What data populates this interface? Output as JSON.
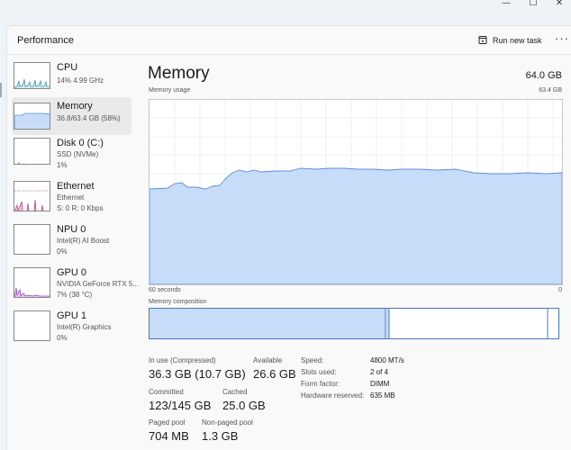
{
  "window": {
    "minimize_glyph": "—",
    "maximize_glyph": "☐",
    "close_glyph": "✕"
  },
  "header": {
    "title": "Performance",
    "run_new_task": "Run new task",
    "more_glyph": "···"
  },
  "sidebar": {
    "items": [
      {
        "name": "CPU",
        "line1": "14%  4.99 GHz",
        "line2": ""
      },
      {
        "name": "Memory",
        "line1": "36.8/63.4 GB (58%)",
        "line2": ""
      },
      {
        "name": "Disk 0 (C:)",
        "line1": "SSD (NVMe)",
        "line2": "1%"
      },
      {
        "name": "Ethernet",
        "line1": "Ethernet",
        "line2": "S: 0  R: 0 Kbps"
      },
      {
        "name": "NPU 0",
        "line1": "Intel(R) AI Boost",
        "line2": "0%"
      },
      {
        "name": "GPU 0",
        "line1": "NVIDIA GeForce RTX 5...",
        "line2": "7%  (38 °C)"
      },
      {
        "name": "GPU 1",
        "line1": "Intel(R) Graphics",
        "line2": "0%"
      }
    ]
  },
  "main": {
    "title": "Memory",
    "total": "64.0 GB",
    "usage_label": "Memory usage",
    "usage_max": "63.4 GB",
    "time_left": "60 seconds",
    "time_right": "0",
    "composition_label": "Memory composition"
  },
  "stats": {
    "in_use_label": "In use (Compressed)",
    "in_use_value": "36.3 GB (10.7 GB)",
    "available_label": "Available",
    "available_value": "26.6 GB",
    "committed_label": "Committed",
    "committed_value": "123/145 GB",
    "cached_label": "Cached",
    "cached_value": "25.0 GB",
    "paged_label": "Paged pool",
    "paged_value": "704 MB",
    "nonpaged_label": "Non-paged pool",
    "nonpaged_value": "1.3 GB"
  },
  "details": {
    "speed_label": "Speed:",
    "speed_value": "4800 MT/s",
    "slots_label": "Slots used:",
    "slots_value": "2 of 4",
    "form_label": "Form factor:",
    "form_value": "DIMM",
    "reserved_label": "Hardware reserved:",
    "reserved_value": "635 MB"
  },
  "colors": {
    "memory_line": "#5c8fd6",
    "memory_fill": "#c7dcf8",
    "cpu": "#2a9bb5",
    "disk": "#5e8a3a",
    "ethernet": "#c1407a",
    "gpu": "#9a3fd0"
  },
  "icons": {
    "run_new_task": "run-task-icon"
  }
}
